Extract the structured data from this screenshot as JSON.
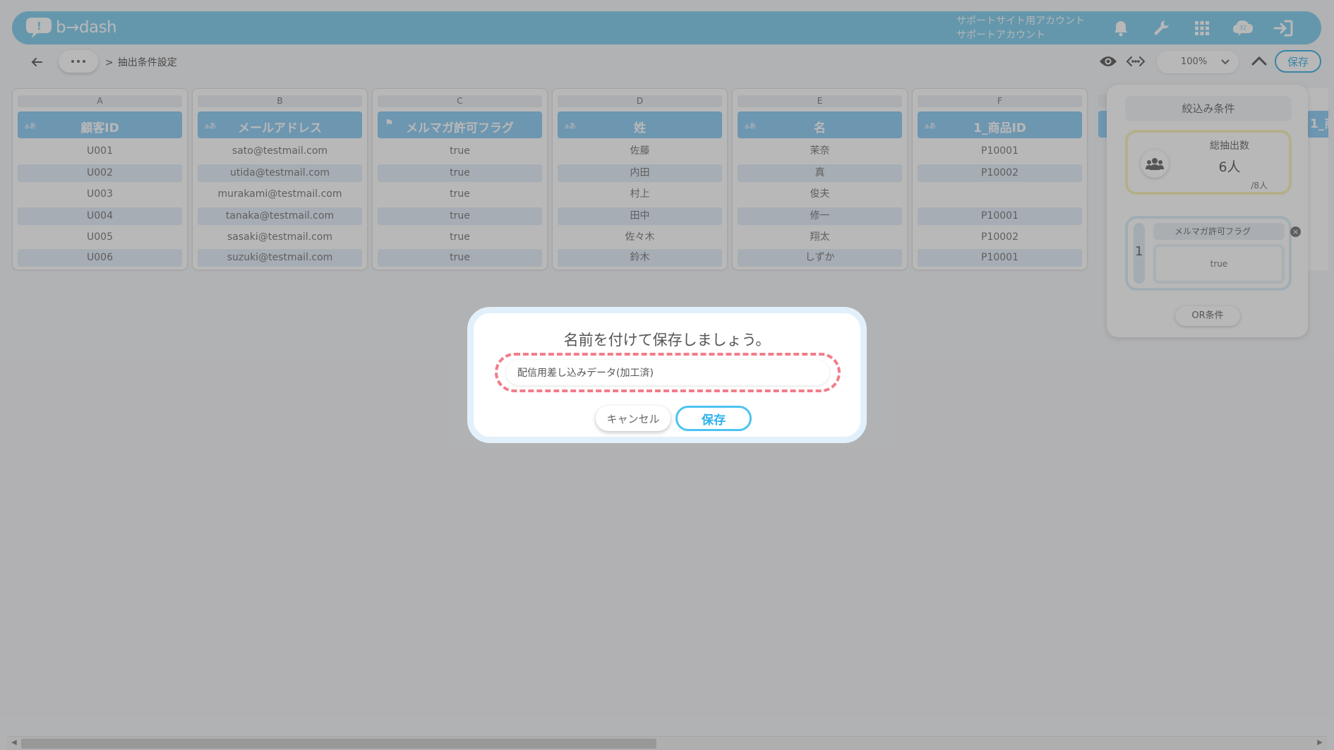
{
  "header": {
    "logo_text": "b→dash",
    "account_line1": "サポートサイト用アカウント",
    "account_line2": "サポートアカウント",
    "icons": [
      "bell-icon",
      "wrench-icon",
      "grid-apps-icon",
      "chat-cloud-icon",
      "logout-icon"
    ],
    "chat_badge": "32",
    "color": "#6fc6ea"
  },
  "toolbar": {
    "breadcrumb_sep": ">",
    "breadcrumb": "抽出条件設定",
    "zoom": "100%",
    "save_label": "保存"
  },
  "grid": {
    "type_label": "aあ",
    "columns": [
      {
        "letter": "A",
        "name": "顧客ID",
        "type": "text",
        "cells": [
          "U001",
          "U002",
          "U003",
          "U004",
          "U005",
          "U006"
        ]
      },
      {
        "letter": "B",
        "name": "メールアドレス",
        "type": "text",
        "cells": [
          "sato@testmail.com",
          "utida@testmail.com",
          "murakami@testmail.com",
          "tanaka@testmail.com",
          "sasaki@testmail.com",
          "suzuki@testmail.com"
        ]
      },
      {
        "letter": "C",
        "name": "メルマガ許可フラグ",
        "type": "flag",
        "cells": [
          "true",
          "true",
          "true",
          "true",
          "true",
          "true"
        ]
      },
      {
        "letter": "D",
        "name": "姓",
        "type": "text",
        "cells": [
          "佐藤",
          "内田",
          "村上",
          "田中",
          "佐々木",
          "鈴木"
        ]
      },
      {
        "letter": "E",
        "name": "名",
        "type": "text",
        "cells": [
          "茉奈",
          "真",
          "俊夫",
          "修一",
          "翔太",
          "しずか"
        ]
      },
      {
        "letter": "F",
        "name": "1_商品ID",
        "type": "text",
        "cells": [
          "P10001",
          "P10002",
          "",
          "P10001",
          "P10002",
          "P10001"
        ]
      }
    ],
    "peek_header": "1_商"
  },
  "filter_panel": {
    "title": "絞込み条件",
    "count_label": "総抽出数",
    "count_value": "6人",
    "count_total": "/8人",
    "condition_number": "1",
    "condition_field": "メルマガ許可フラグ",
    "condition_value": "true",
    "or_button": "OR条件"
  },
  "modal": {
    "title": "名前を付けて保存しましょう。",
    "input_value": "配信用差し込みデータ(加工済)",
    "cancel_label": "キャンセル",
    "save_label": "保存",
    "highlight_color": "#f27c89"
  },
  "scrollbar": {
    "left_arrow": "◀",
    "right_arrow": "▶"
  }
}
